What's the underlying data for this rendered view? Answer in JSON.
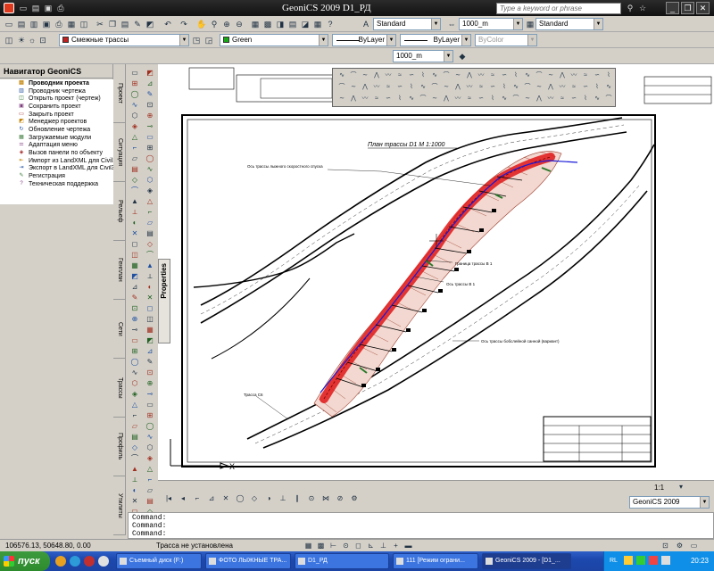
{
  "window": {
    "title": "GeoniCS 2009  D1_РД",
    "search_placeholder": "Type a keyword or phrase",
    "buttons": [
      "_",
      "❐",
      "✕"
    ]
  },
  "toolbar1": {
    "text_style": "Standard",
    "dim_scale": "1000_m",
    "table_style": "Standard"
  },
  "toolbar2": {
    "layer": "Смежные трассы",
    "color": "Green",
    "color_hex": "#18a818",
    "linetype": "ByLayer",
    "lineweight": "ByLayer",
    "plotstyle": "ByColor"
  },
  "toolbar3": {
    "scale": "1000_m"
  },
  "navigator": {
    "title": "Навигатор GeoniCS",
    "items": [
      {
        "label": "Проводник проекта",
        "icon": "folder-tree-icon",
        "selected": true
      },
      {
        "label": "Проводник чертежа",
        "icon": "drawing-tree-icon"
      },
      {
        "label": "Открыть проект (чертеж)",
        "icon": "open-folder-icon"
      },
      {
        "label": "Сохранить проект",
        "icon": "save-icon"
      },
      {
        "label": "Закрыть проект",
        "icon": "close-project-icon"
      },
      {
        "label": "Менеджер проектов",
        "icon": "manager-icon"
      },
      {
        "label": "Обновление чертежа",
        "icon": "refresh-icon"
      },
      {
        "label": "Загружаемые модули",
        "icon": "modules-icon"
      },
      {
        "label": "Адаптация меню",
        "icon": "menu-adapt-icon"
      },
      {
        "label": "Вызов панели по объекту",
        "icon": "panel-call-icon"
      },
      {
        "label": "Импорт из LandXML для Civil3",
        "icon": "import-icon"
      },
      {
        "label": "Экспорт в LandXML для Civil3",
        "icon": "export-icon"
      },
      {
        "label": "Регистрация",
        "icon": "registration-icon"
      },
      {
        "label": "Техническая поддержка",
        "icon": "support-icon"
      }
    ]
  },
  "vertical_tabs": [
    "Проект",
    "Ситуация",
    "Рельеф",
    "Генплан",
    "Сети",
    "Трассы",
    "Профиль",
    "Утилиты"
  ],
  "properties_tab": "Properties",
  "drawing": {
    "plan_title": "План трассы  D1  М 1:1000",
    "labels": {
      "ski_axis": "Ось трассы лыжного скоростного спуска",
      "boundary": "Граница трассы В 1",
      "axis_b1": "Ось трассы В 1",
      "bob_axis": "Ось трассы бобслейной санной (вариант)",
      "trace_c6": "Трасса С6"
    },
    "corridor_color": "#e01818",
    "axis_color": "#1a1ad8"
  },
  "model_tabs": {
    "scale": "1:1",
    "workspace": "GeoniCS 2009"
  },
  "command": {
    "lines": [
      "Command:",
      "Command:",
      "Command:"
    ]
  },
  "status": {
    "coordinates": "106576.13, 50648.80, 0.00",
    "message": "Трасса не установлена"
  },
  "taskbar": {
    "start": "пуск",
    "tasks": [
      "Съемный диск (F:)",
      "ФОТО ЛЫЖНЫЕ ТРА...",
      "D1_РД",
      "111 [Режим ограни...",
      "GeoniCS 2009 - [D1_..."
    ],
    "active_index": 4,
    "lang": "RL",
    "clock": "20:23"
  }
}
